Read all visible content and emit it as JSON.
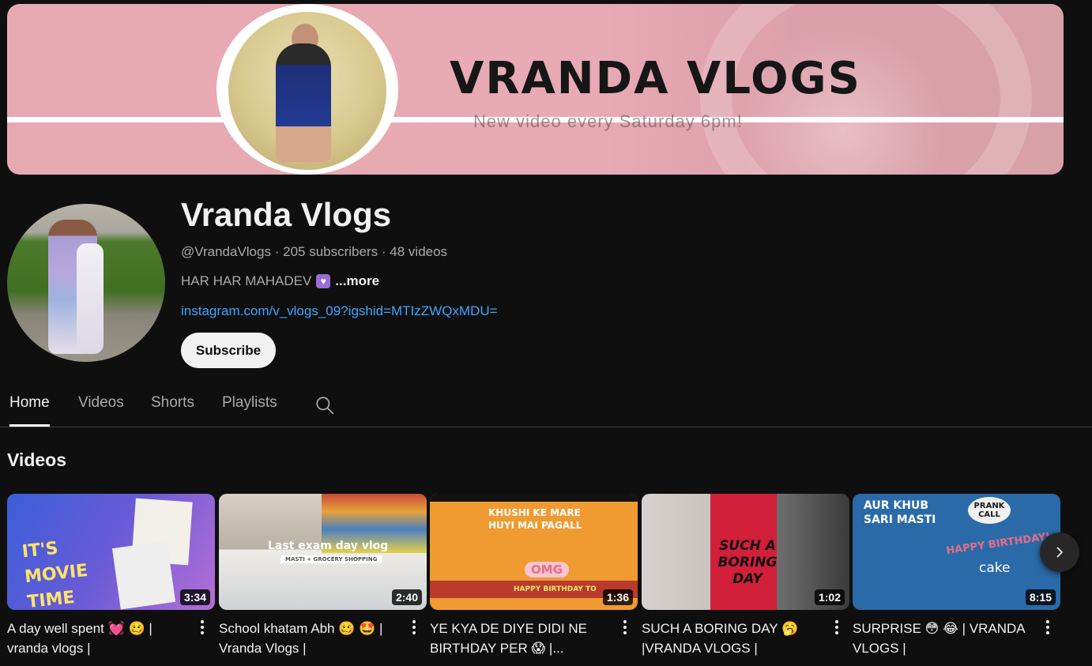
{
  "banner": {
    "title": "VRANDA VLOGS",
    "subtitle": "New video every Saturday 6pm!"
  },
  "channel": {
    "name": "Vranda Vlogs",
    "handle": "@VrandaVlogs",
    "subscribers": "205 subscribers",
    "video_count": "48 videos",
    "separator": "·",
    "description": "HAR HAR MAHADEV",
    "more_label": "...more",
    "link": "instagram.com/v_vlogs_09?igshid=MTIzZWQxMDU=",
    "subscribe_label": "Subscribe"
  },
  "tabs": [
    {
      "label": "Home",
      "active": true
    },
    {
      "label": "Videos",
      "active": false
    },
    {
      "label": "Shorts",
      "active": false
    },
    {
      "label": "Playlists",
      "active": false
    }
  ],
  "section": {
    "title": "Videos"
  },
  "videos": [
    {
      "title": "A day well spent 💓 🥴 | vranda vlogs |",
      "duration": "3:34",
      "thumb_text": "IT'S MOVIE TIME"
    },
    {
      "title": "School khatam Abh 🥴 🤩 | Vranda Vlogs |",
      "duration": "2:40",
      "thumb_text": "Last exam day vlog",
      "thumb_sub": "MASTI + GROCERY SHOPPING"
    },
    {
      "title": "YE KYA DE DIYE DIDI NE BIRTHDAY PER 😱 |...",
      "duration": "1:36",
      "thumb_text": "KHUSHI KE MARE HUYI MAI PAGALL",
      "thumb_sub": "HAPPY BIRTHDAY TO",
      "thumb_badge": "OMG"
    },
    {
      "title": "SUCH A BORING DAY 🥱 |VRANDA VLOGS |",
      "duration": "1:02",
      "thumb_text": "SUCH A BORING DAY"
    },
    {
      "title": "SURPRISE 😳 😂 | VRANDA VLOGS |",
      "duration": "8:15",
      "thumb_text": "AUR KHUB SARI MASTI",
      "thumb_sub": "HAPPY BIRTHDAY!",
      "thumb_badge": "PRANK CALL",
      "thumb_extra": "cake"
    }
  ],
  "colors": {
    "background": "#0f0f0f",
    "link": "#3ea6ff",
    "banner_pink": "#e8aab4"
  }
}
